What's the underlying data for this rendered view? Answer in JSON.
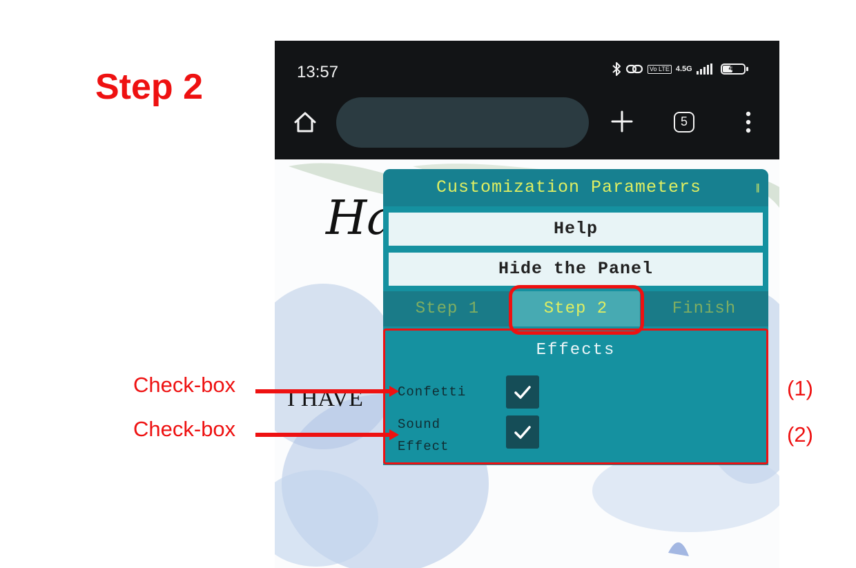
{
  "slide": {
    "title": "Step 2",
    "annotations": [
      {
        "label": "Check-box",
        "number": "(1)"
      },
      {
        "label": "Check-box",
        "number": "(2)"
      }
    ],
    "highlight_color": "#ee1111"
  },
  "status_bar": {
    "time": "13:57",
    "network_badge": "Vo LTE",
    "network_type": "4.5G",
    "battery": "46",
    "icons": [
      "bluetooth-icon",
      "hotspot-link-icon",
      "volte-icon",
      "signal-icon",
      "battery-icon"
    ]
  },
  "browser": {
    "tab_count": "5",
    "icons": [
      "home-icon",
      "plus-icon",
      "tabs-icon",
      "more-vert-icon"
    ]
  },
  "page": {
    "heading_fragment": "Ha",
    "text_fragment": "I HAVE"
  },
  "panel": {
    "title": "Customization Parameters",
    "collapse_glyph": "∥",
    "help_label": "Help",
    "hide_label": "Hide the Panel",
    "tabs": [
      {
        "label": "Step 1",
        "active": false
      },
      {
        "label": "Step 2",
        "active": true
      },
      {
        "label": "Finish",
        "active": false
      }
    ],
    "effects": {
      "title": "Effects",
      "options": [
        {
          "label_line1": "Confetti",
          "label_line2": "",
          "checked": true
        },
        {
          "label_line1": "Sound",
          "label_line2": "Effect",
          "checked": true
        }
      ]
    },
    "colors": {
      "panel": "#1591a0",
      "title_bar": "#178090",
      "accent_text": "#dfee62",
      "checkbox": "#154d57"
    }
  }
}
